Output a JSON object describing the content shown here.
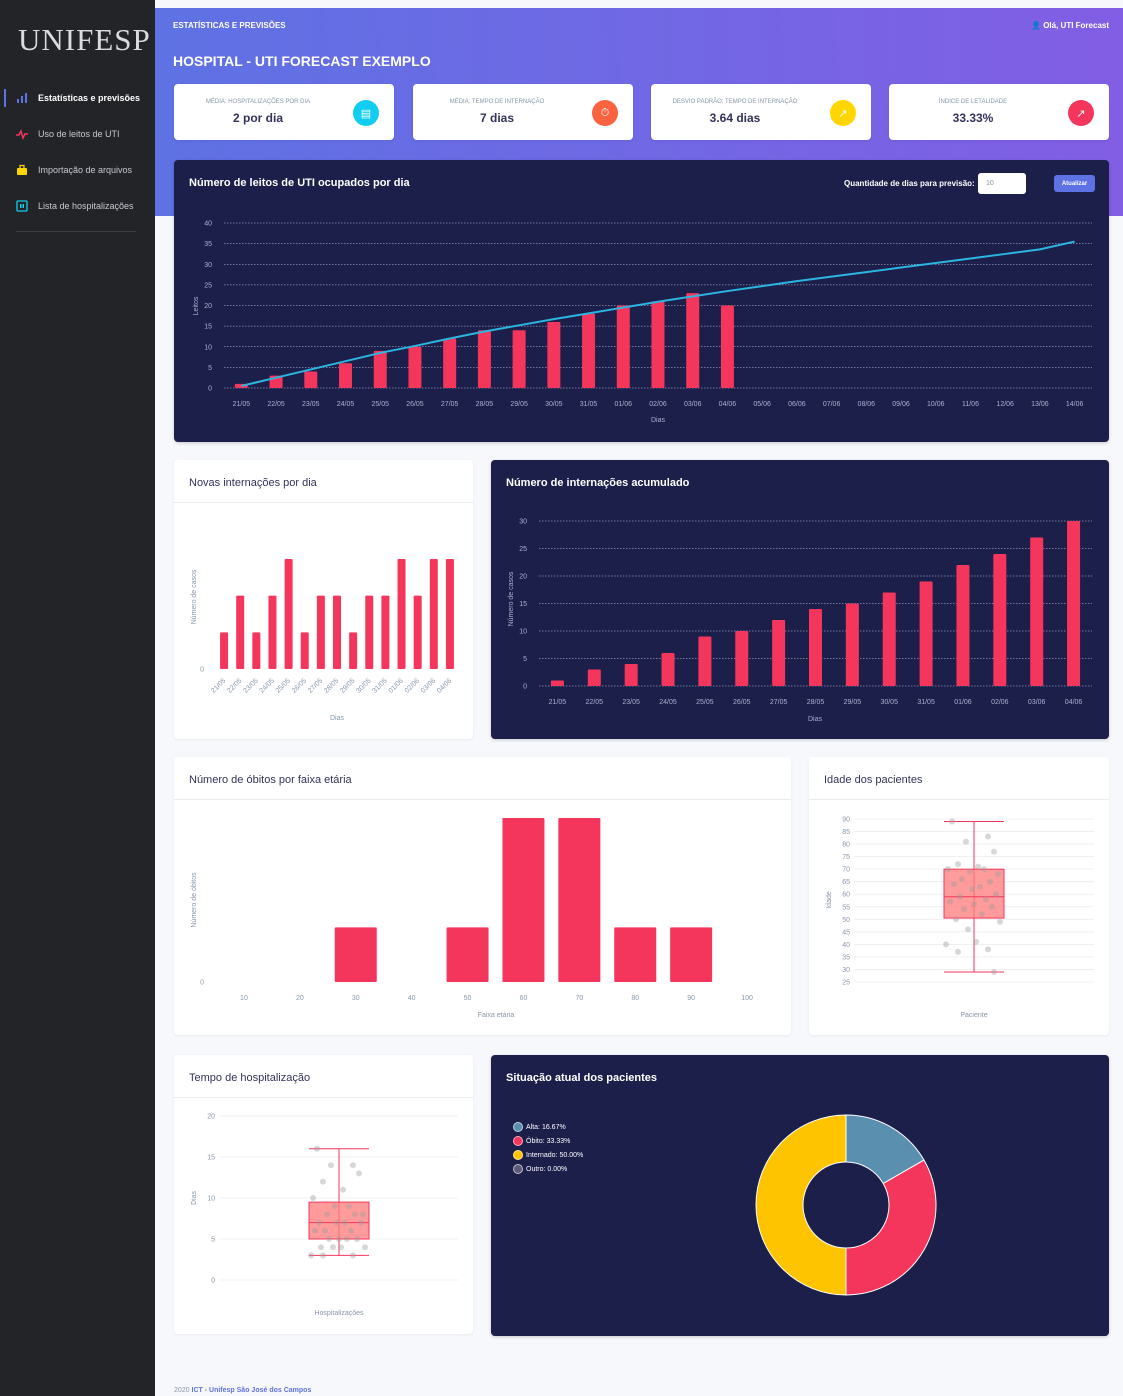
{
  "sidebar": {
    "logo": "UNIFESP",
    "items": [
      {
        "label": "Estatísticas e previsões",
        "icon": "bar-chart-icon",
        "color": "#5e72e4"
      },
      {
        "label": "Uso de leitos de UTI",
        "icon": "pulse-icon",
        "color": "#f5365c"
      },
      {
        "label": "Importação de arquivos",
        "icon": "briefcase-icon",
        "color": "#ffd600"
      },
      {
        "label": "Lista de hospitalizações",
        "icon": "list-icon",
        "color": "#11cdef"
      }
    ]
  },
  "header": {
    "breadcrumb": "ESTATÍSTICAS E PREVISÕES",
    "greeting": "Olá, UTI Forecast",
    "title": "HOSPITAL - UTI FORECAST EXEMPLO"
  },
  "stats": [
    {
      "label": "MÉDIA: HOSPITALIZAÇÕES POR DIA",
      "value": "2 por dia",
      "icon": "bed-icon",
      "color": "#11cdef"
    },
    {
      "label": "MÉDIA: TEMPO DE INTERNAÇÃO",
      "value": "7 dias",
      "icon": "stopwatch-icon",
      "color": "#fb6340"
    },
    {
      "label": "DESVIO PADRÃO: TEMPO DE INTERNAÇÃO",
      "value": "3.64 dias",
      "icon": "chart-up-icon",
      "color": "#ffd600"
    },
    {
      "label": "ÍNDICE DE LETALIDADE",
      "value": "33.33%",
      "icon": "chart-up-icon",
      "color": "#f5365c"
    }
  ],
  "forecast_form": {
    "label": "Quantidade de dias para previsão:",
    "input_value": "10",
    "button": "Atualizar"
  },
  "footer": {
    "year": "2020",
    "link": "ICT - Unifesp São José dos Campos"
  },
  "chart_data": [
    {
      "id": "leitos",
      "type": "bar",
      "title": "Número de leitos de UTI ocupados por dia",
      "xlabel": "Dias",
      "ylabel": "Leitos",
      "ylim": [
        0,
        40
      ],
      "yticks": [
        0,
        5,
        10,
        15,
        20,
        25,
        30,
        35,
        40
      ],
      "categories": [
        "21/05",
        "22/05",
        "23/05",
        "24/05",
        "25/05",
        "26/05",
        "27/05",
        "28/05",
        "29/05",
        "30/05",
        "31/05",
        "01/06",
        "02/06",
        "03/06",
        "04/06",
        "05/06",
        "06/06",
        "07/06",
        "08/06",
        "09/06",
        "10/06",
        "11/06",
        "12/06",
        "13/06",
        "14/06"
      ],
      "values": [
        1,
        3,
        4,
        6,
        9,
        10,
        12,
        14,
        14,
        16,
        18,
        20,
        21,
        23,
        20,
        null,
        null,
        null,
        null,
        null,
        null,
        null,
        null,
        null,
        null
      ],
      "forecast": [
        0.5,
        2.5,
        4.5,
        6.5,
        8.5,
        10.2,
        12,
        13.7,
        15.2,
        16.7,
        18.1,
        19.5,
        20.9,
        22.2,
        23.5,
        24.7,
        25.9,
        27.0,
        28.1,
        29.2,
        30.3,
        31.4,
        32.5,
        33.6,
        35.5
      ],
      "bar_color": "#f5365c",
      "line_color": "#2bb5e0",
      "grid": true
    },
    {
      "id": "novas",
      "type": "bar",
      "title": "Novas internações por dia",
      "xlabel": "Dias",
      "ylabel": "Número de casos",
      "categories": [
        "21/05",
        "22/05",
        "23/05",
        "24/05",
        "25/05",
        "26/05",
        "27/05",
        "28/05",
        "29/05",
        "30/05",
        "31/05",
        "01/06",
        "02/06",
        "03/06",
        "04/06"
      ],
      "values": [
        1,
        2,
        1,
        2,
        3,
        1,
        2,
        2,
        1,
        2,
        2,
        3,
        2,
        3,
        3
      ],
      "yticks": [
        0
      ],
      "ymax": 3,
      "bar_color": "#f5365c",
      "grid": false
    },
    {
      "id": "acumulado",
      "type": "bar",
      "title": "Número de internações acumulado",
      "xlabel": "Dias",
      "ylabel": "Número de casos",
      "ylim": [
        0,
        30
      ],
      "yticks": [
        0,
        5,
        10,
        15,
        20,
        25,
        30
      ],
      "categories": [
        "21/05",
        "22/05",
        "23/05",
        "24/05",
        "25/05",
        "26/05",
        "27/05",
        "28/05",
        "29/05",
        "30/05",
        "31/05",
        "01/06",
        "02/06",
        "03/06",
        "04/06"
      ],
      "values": [
        1,
        3,
        4,
        6,
        9,
        10,
        12,
        14,
        15,
        17,
        19,
        22,
        24,
        27,
        30
      ],
      "bar_color": "#f5365c",
      "grid": true
    },
    {
      "id": "obitos",
      "type": "bar",
      "title": "Número de óbitos por faixa etária",
      "xlabel": "Faixa etária",
      "ylabel": "Número de óbitos",
      "categories": [
        "10",
        "20",
        "30",
        "40",
        "50",
        "60",
        "70",
        "80",
        "90",
        "100"
      ],
      "values": [
        0,
        0,
        1,
        0,
        1,
        3,
        3,
        1,
        1,
        0
      ],
      "yticks": [
        0
      ],
      "ymax": 3,
      "bar_color": "#f5365c",
      "grid": false
    },
    {
      "id": "idade",
      "type": "box",
      "title": "Idade dos pacientes",
      "xlabel": "Paciente",
      "ylabel": "Idade",
      "ylim": [
        25,
        90
      ],
      "yticks": [
        25,
        30,
        35,
        40,
        45,
        50,
        55,
        60,
        65,
        70,
        75,
        80,
        85,
        90
      ],
      "min": 29,
      "q1": 50.5,
      "median": 59,
      "q3": 70,
      "max": 89,
      "points": [
        89,
        83,
        81,
        77,
        72,
        71,
        70,
        70,
        69,
        68,
        66,
        65,
        64,
        63,
        62,
        60,
        59,
        58,
        57,
        56,
        55,
        54,
        52,
        50,
        49,
        46,
        41,
        40,
        38,
        37,
        29
      ],
      "color": "#f5365c"
    },
    {
      "id": "tempo",
      "type": "box",
      "title": "Tempo de hospitalização",
      "xlabel": "Hospitalizações",
      "ylabel": "Dias",
      "ylim": [
        0,
        20
      ],
      "yticks": [
        0,
        5,
        10,
        15,
        20
      ],
      "min": 3,
      "q1": 5,
      "median": 7,
      "q3": 9.5,
      "max": 16,
      "points": [
        16,
        14,
        14,
        13,
        12,
        11,
        10,
        9,
        9,
        8,
        8,
        8,
        7,
        7,
        7,
        7,
        6,
        6,
        6,
        5,
        5,
        5,
        5,
        4,
        4,
        4,
        4,
        3,
        3,
        3
      ],
      "color": "#f5365c"
    },
    {
      "id": "situacao",
      "type": "pie",
      "title": "Situação atual dos pacientes",
      "labels": [
        "Alta",
        "Óbito",
        "Internado",
        "Outro"
      ],
      "legend_text": [
        "Alta: 16.67%",
        "Óbito: 33.33%",
        "Internado: 50.00%",
        "Outro: 0.00%"
      ],
      "values": [
        16.67,
        33.33,
        50.0,
        0.0
      ],
      "colors": [
        "#5a8fb0",
        "#f5365c",
        "#ffc400",
        "#5e5a78"
      ],
      "legend": "top-left"
    }
  ]
}
